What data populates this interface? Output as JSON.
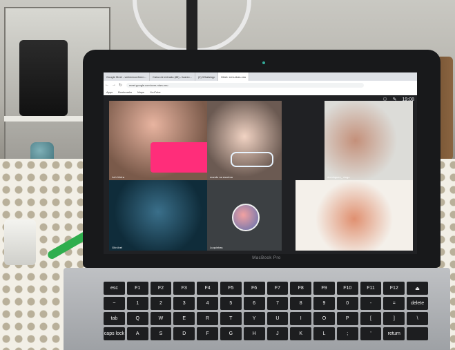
{
  "scene": {
    "laptop_brand": "MacBook Pro"
  },
  "browser": {
    "tabs": [
      "Google Meet - webex/conferen...",
      "Caixa de entrada (88) - lizanio...",
      "(2) WhatsApp",
      "Meet: xvm-nkzs-xnu"
    ],
    "url": "meet.google.com/xvm-nkzs-xnu",
    "bookmarks": [
      "Apps",
      "Bookmarks",
      "Maps",
      "YouTube"
    ]
  },
  "meet": {
    "time": "19:08",
    "participants": [
      "Leh Vieira",
      "mundo na escrima",
      "dominguez_ viogo",
      "Gilv Arel",
      "Luquinhas",
      ""
    ]
  },
  "keyboard": {
    "rows": [
      [
        "esc",
        "F1",
        "F2",
        "F3",
        "F4",
        "F5",
        "F6",
        "F7",
        "F8",
        "F9",
        "F10",
        "F11",
        "F12",
        "⏏"
      ],
      [
        "~",
        "1",
        "2",
        "3",
        "4",
        "5",
        "6",
        "7",
        "8",
        "9",
        "0",
        "-",
        "=",
        "delete"
      ],
      [
        "tab",
        "Q",
        "W",
        "E",
        "R",
        "T",
        "Y",
        "U",
        "I",
        "O",
        "P",
        "[",
        "]",
        "\\"
      ],
      [
        "caps lock",
        "A",
        "S",
        "D",
        "F",
        "G",
        "H",
        "J",
        "K",
        "L",
        ";",
        "'",
        "return",
        ""
      ]
    ]
  }
}
